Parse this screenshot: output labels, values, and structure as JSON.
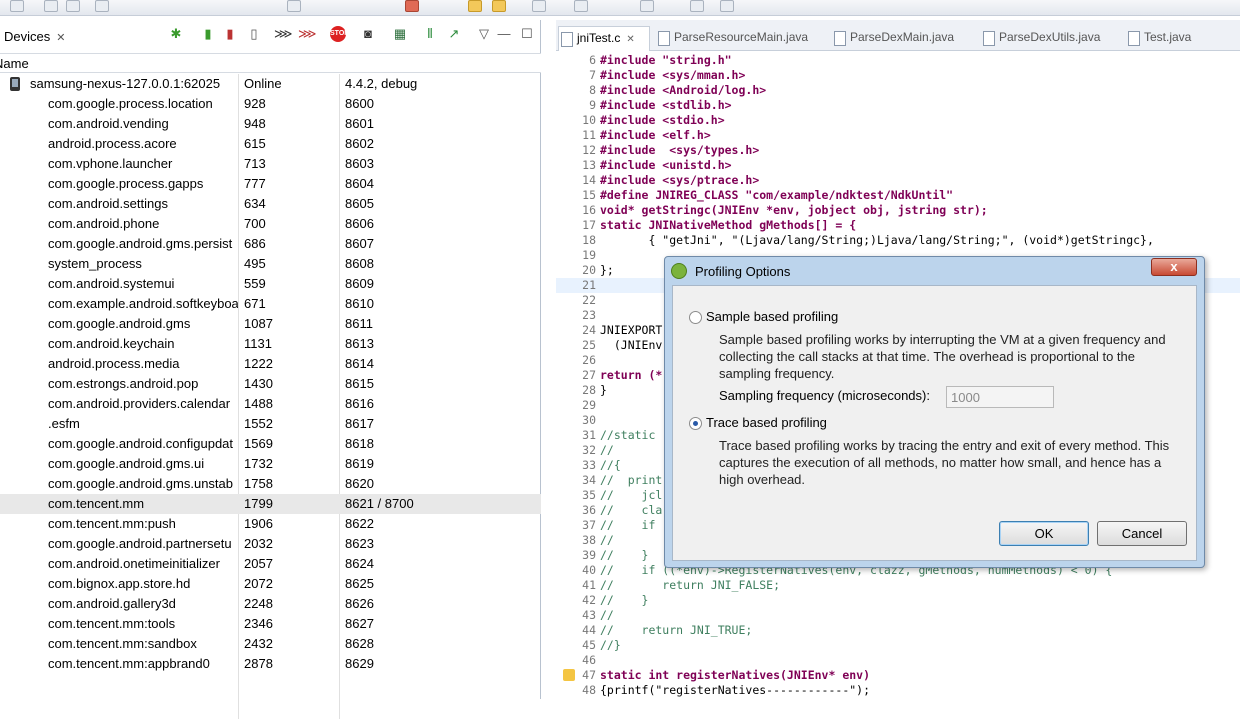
{
  "devices_view": {
    "tab_label": "Devices",
    "column_name": "Name",
    "device": {
      "name": "samsung-nexus-127.0.0.1:62025",
      "state": "Online",
      "version": "4.4.2, debug"
    },
    "processes": [
      {
        "name": "com.google.process.location",
        "pid": "928",
        "port": "8600"
      },
      {
        "name": "com.android.vending",
        "pid": "948",
        "port": "8601"
      },
      {
        "name": "android.process.acore",
        "pid": "615",
        "port": "8602"
      },
      {
        "name": "com.vphone.launcher",
        "pid": "713",
        "port": "8603"
      },
      {
        "name": "com.google.process.gapps",
        "pid": "777",
        "port": "8604"
      },
      {
        "name": "com.android.settings",
        "pid": "634",
        "port": "8605"
      },
      {
        "name": "com.android.phone",
        "pid": "700",
        "port": "8606"
      },
      {
        "name": "com.google.android.gms.persist",
        "pid": "686",
        "port": "8607"
      },
      {
        "name": "system_process",
        "pid": "495",
        "port": "8608"
      },
      {
        "name": "com.android.systemui",
        "pid": "559",
        "port": "8609"
      },
      {
        "name": "com.example.android.softkeyboa",
        "pid": "671",
        "port": "8610"
      },
      {
        "name": "com.google.android.gms",
        "pid": "1087",
        "port": "8611"
      },
      {
        "name": "com.android.keychain",
        "pid": "1131",
        "port": "8613"
      },
      {
        "name": "android.process.media",
        "pid": "1222",
        "port": "8614"
      },
      {
        "name": "com.estrongs.android.pop",
        "pid": "1430",
        "port": "8615"
      },
      {
        "name": "com.android.providers.calendar",
        "pid": "1488",
        "port": "8616"
      },
      {
        "name": ".esfm",
        "pid": "1552",
        "port": "8617"
      },
      {
        "name": "com.google.android.configupdat",
        "pid": "1569",
        "port": "8618"
      },
      {
        "name": "com.google.android.gms.ui",
        "pid": "1732",
        "port": "8619"
      },
      {
        "name": "com.google.android.gms.unstab",
        "pid": "1758",
        "port": "8620"
      },
      {
        "name": "com.tencent.mm",
        "pid": "1799",
        "port": "8621 / 8700"
      },
      {
        "name": "com.tencent.mm:push",
        "pid": "1906",
        "port": "8622"
      },
      {
        "name": "com.google.android.partnersetu",
        "pid": "2032",
        "port": "8623"
      },
      {
        "name": "com.android.onetimeinitializer",
        "pid": "2057",
        "port": "8624"
      },
      {
        "name": "com.bignox.app.store.hd",
        "pid": "2072",
        "port": "8625"
      },
      {
        "name": "com.android.gallery3d",
        "pid": "2248",
        "port": "8626"
      },
      {
        "name": "com.tencent.mm:tools",
        "pid": "2346",
        "port": "8627"
      },
      {
        "name": "com.tencent.mm:sandbox",
        "pid": "2432",
        "port": "8628"
      },
      {
        "name": "com.tencent.mm:appbrand0",
        "pid": "2878",
        "port": "8629"
      }
    ]
  },
  "editor": {
    "tabs": [
      "jniTest.c",
      "ParseResourceMain.java",
      "ParseDexMain.java",
      "ParseDexUtils.java",
      "Test.java"
    ],
    "lines": [
      {
        "n": "6",
        "text": "#include \"string.h\""
      },
      {
        "n": "7",
        "text": "#include <sys/mman.h>"
      },
      {
        "n": "8",
        "text": "#include <Android/log.h>"
      },
      {
        "n": "9",
        "text": "#include <stdlib.h>"
      },
      {
        "n": "10",
        "text": "#include <stdio.h>"
      },
      {
        "n": "11",
        "text": "#include <elf.h>"
      },
      {
        "n": "12",
        "text": "#include  <sys/types.h>"
      },
      {
        "n": "13",
        "text": "#include <unistd.h>"
      },
      {
        "n": "14",
        "text": "#include <sys/ptrace.h>"
      },
      {
        "n": "15",
        "text": "#define JNIREG_CLASS \"com/example/ndktest/NdkUntil\""
      },
      {
        "n": "16",
        "text": "void* getStringc(JNIEnv *env, jobject obj, jstring str);"
      },
      {
        "n": "17",
        "text": "static JNINativeMethod gMethods[] = {"
      },
      {
        "n": "18",
        "text": "       { \"getJni\", \"(Ljava/lang/String;)Ljava/lang/String;\", (void*)getStringc},"
      },
      {
        "n": "19",
        "text": ""
      },
      {
        "n": "20",
        "text": "};"
      },
      {
        "n": "21",
        "text": ""
      },
      {
        "n": "22",
        "text": ""
      },
      {
        "n": "23",
        "text": ""
      },
      {
        "n": "24",
        "text": "JNIEXPORT"
      },
      {
        "n": "25",
        "text": "  (JNIEnv"
      },
      {
        "n": "26",
        "text": ""
      },
      {
        "n": "27",
        "text": "return (*"
      },
      {
        "n": "28",
        "text": "}"
      },
      {
        "n": "29",
        "text": ""
      },
      {
        "n": "30",
        "text": ""
      },
      {
        "n": "31",
        "text": "//static"
      },
      {
        "n": "32",
        "text": "//"
      },
      {
        "n": "33",
        "text": "//{"
      },
      {
        "n": "34",
        "text": "//  print"
      },
      {
        "n": "35",
        "text": "//    jcl"
      },
      {
        "n": "36",
        "text": "//    cla"
      },
      {
        "n": "37",
        "text": "//    if"
      },
      {
        "n": "38",
        "text": "//"
      },
      {
        "n": "39",
        "text": "//    }"
      },
      {
        "n": "40",
        "text": "//    if ((*env)->RegisterNatives(env, clazz, gMethods, numMethods) < 0) {"
      },
      {
        "n": "41",
        "text": "//       return JNI_FALSE;"
      },
      {
        "n": "42",
        "text": "//    }"
      },
      {
        "n": "43",
        "text": "//"
      },
      {
        "n": "44",
        "text": "//    return JNI_TRUE;"
      },
      {
        "n": "45",
        "text": "//}"
      },
      {
        "n": "46",
        "text": ""
      },
      {
        "n": "47",
        "text": "static int registerNatives(JNIEnv* env)"
      },
      {
        "n": "48",
        "text": "{printf(\"registerNatives------------\");"
      }
    ]
  },
  "dialog": {
    "title": "Profiling Options",
    "close_label": "x",
    "sample_label": "Sample based profiling",
    "sample_desc": "Sample based profiling works by interrupting the VM at a given frequency and collecting the call stacks at that time. The overhead is proportional to the sampling frequency.",
    "freq_label": "Sampling frequency (microseconds):",
    "freq_placeholder": "1000",
    "trace_label": "Trace based profiling",
    "trace_desc": "Trace based profiling works by tracing the entry and exit of every method. This captures the execution of all methods, no matter how small, and hence has a high overhead.",
    "selected": "trace",
    "ok_label": "OK",
    "cancel_label": "Cancel"
  },
  "colors": {
    "accent": "#2a5aa8",
    "keyword": "#7f0055",
    "string": "#2a00ff",
    "comment": "#3f7f5f"
  }
}
